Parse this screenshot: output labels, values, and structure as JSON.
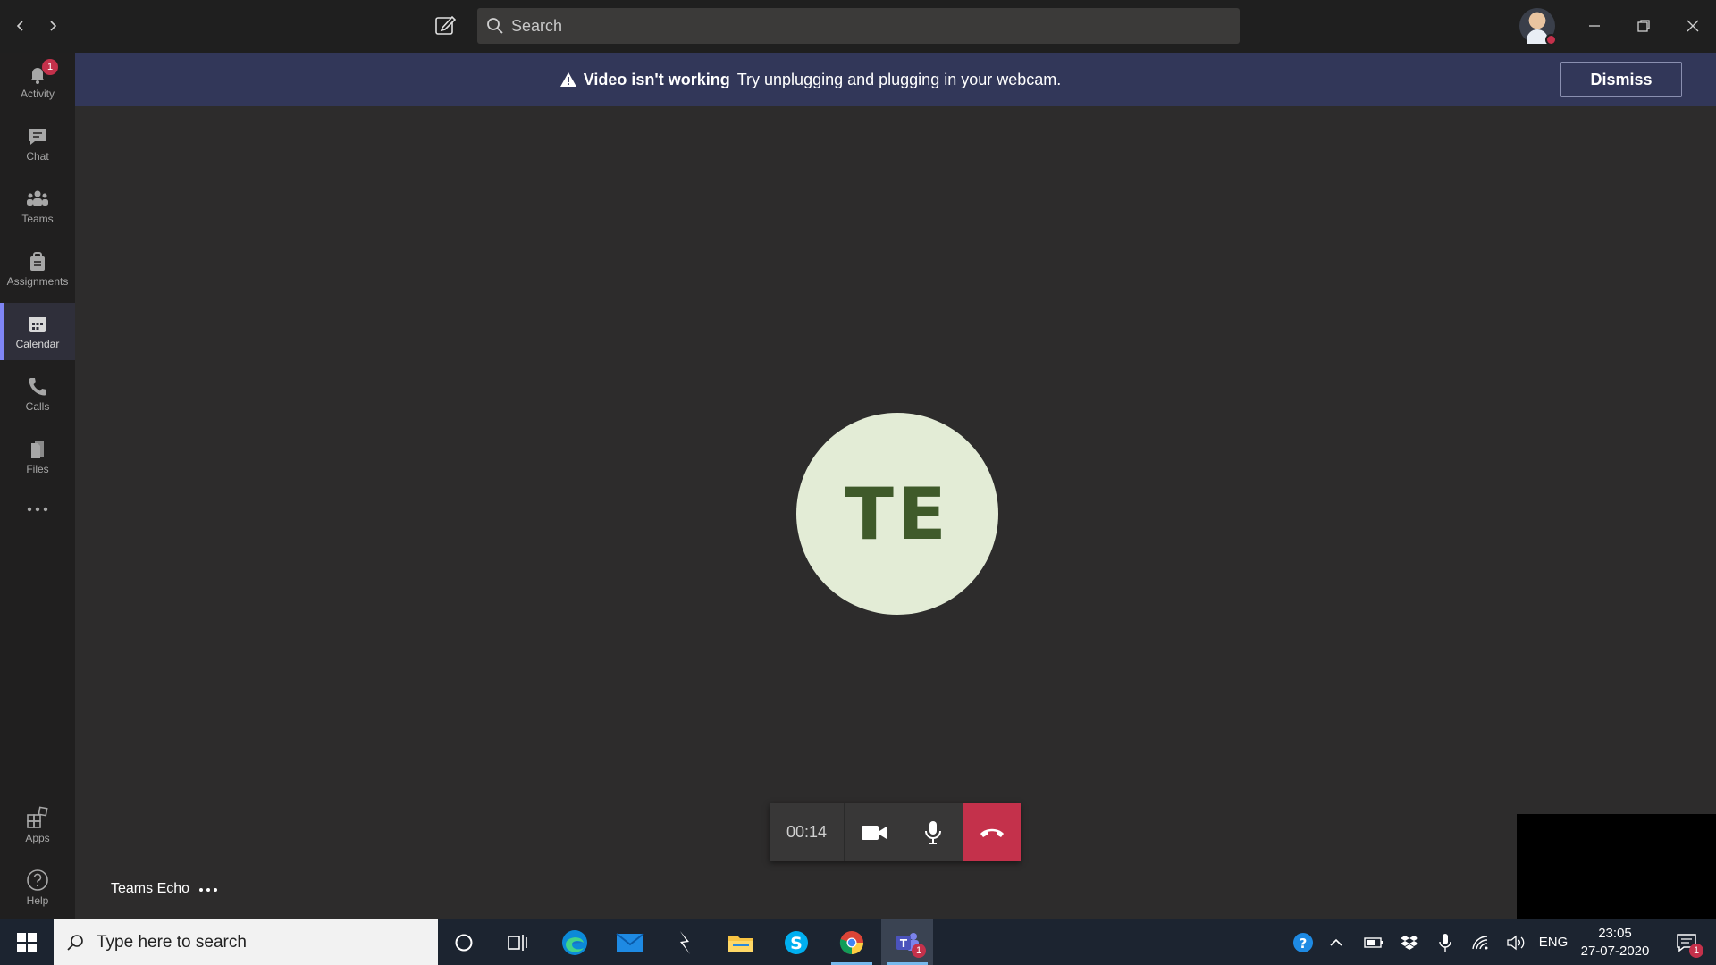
{
  "search": {
    "placeholder": "Search"
  },
  "rail": {
    "items": [
      {
        "label": "Activity",
        "badge": "1"
      },
      {
        "label": "Chat"
      },
      {
        "label": "Teams"
      },
      {
        "label": "Assignments"
      },
      {
        "label": "Calendar"
      },
      {
        "label": "Calls"
      },
      {
        "label": "Files"
      }
    ],
    "bottom": [
      {
        "label": "Apps"
      },
      {
        "label": "Help"
      }
    ],
    "active": "Calendar"
  },
  "banner": {
    "title": "Video isn't working",
    "message": "Try unplugging and plugging in your webcam.",
    "dismiss_label": "Dismiss"
  },
  "call": {
    "participant_initials": "TE",
    "participant_name": "Teams Echo",
    "duration": "00:14"
  },
  "taskbar": {
    "search_placeholder": "Type here to search",
    "teams_badge": "1",
    "language": "ENG",
    "time": "23:05",
    "date": "27-07-2020",
    "notifications": "1"
  },
  "colors": {
    "accent": "#7f85f5",
    "banner_bg": "#323759",
    "hangup": "#c4314b",
    "avatar_bg": "#e3ecd6",
    "avatar_text": "#3f5a2a"
  }
}
